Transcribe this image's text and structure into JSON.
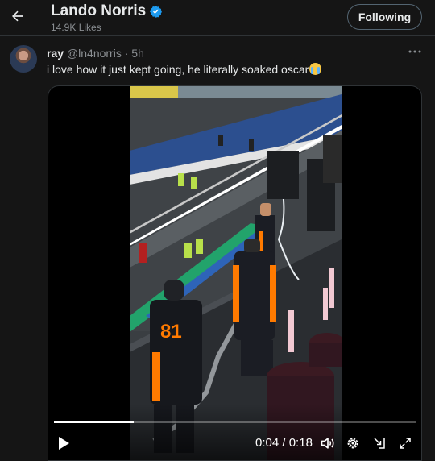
{
  "header": {
    "title": "Lando Norris",
    "likes": "14.9K Likes",
    "follow_label": "Following",
    "back_icon": "arrow-left-icon",
    "verified_icon": "verified-badge-icon",
    "verified_color": "#1d9bf0"
  },
  "post": {
    "author_name": "ray",
    "handle": "@ln4norris",
    "separator": "·",
    "time": "5h",
    "text": "i love how it just kept going, he literally soaked oscar",
    "emoji": "loudly-crying-face",
    "more_icon": "more-dots-icon"
  },
  "video": {
    "current_time": "0:04",
    "time_separator": "/",
    "duration": "0:18",
    "progress_fraction": 0.22,
    "controls": [
      "play-icon",
      "volume-icon",
      "settings-gear-icon",
      "pop-out-icon",
      "fullscreen-icon"
    ]
  },
  "colors": {
    "background": "#151515",
    "text_primary": "#e7e9ea",
    "text_secondary": "#8b8f93",
    "border": "#2f3336",
    "mclaren_orange": "#ff7a00"
  }
}
